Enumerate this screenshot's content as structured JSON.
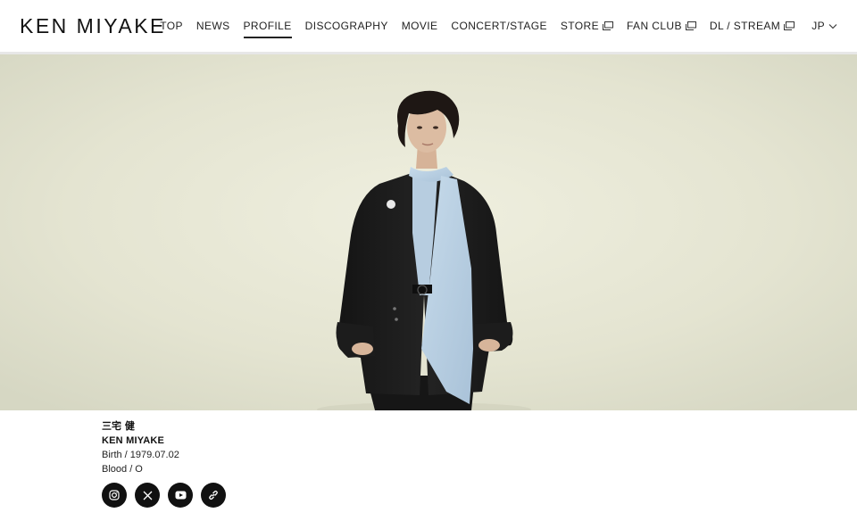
{
  "header": {
    "logo": "KEN MIYAKE",
    "nav": [
      {
        "label": "TOP",
        "external": false,
        "active": false
      },
      {
        "label": "NEWS",
        "external": false,
        "active": false
      },
      {
        "label": "PROFILE",
        "external": false,
        "active": true
      },
      {
        "label": "DISCOGRAPHY",
        "external": false,
        "active": false
      },
      {
        "label": "MOVIE",
        "external": false,
        "active": false
      },
      {
        "label": "CONCERT/STAGE",
        "external": false,
        "active": false
      },
      {
        "label": "STORE",
        "external": true,
        "active": false
      },
      {
        "label": "FAN CLUB",
        "external": true,
        "active": false
      },
      {
        "label": "DL / STREAM",
        "external": true,
        "active": false
      }
    ],
    "language": "JP"
  },
  "profile": {
    "name_jp": "三宅 健",
    "name_en": "KEN MIYAKE",
    "birth": "Birth / 1979.07.02",
    "blood": "Blood / O"
  },
  "socials": [
    {
      "icon": "instagram-icon"
    },
    {
      "icon": "x-icon"
    },
    {
      "icon": "youtube-icon"
    },
    {
      "icon": "link-icon"
    }
  ],
  "colors": {
    "hero_background": "#e6e5d3",
    "jacket": "#1b1b1b",
    "scarf": "#b9d0e2",
    "shirt": "#b7cde0"
  }
}
